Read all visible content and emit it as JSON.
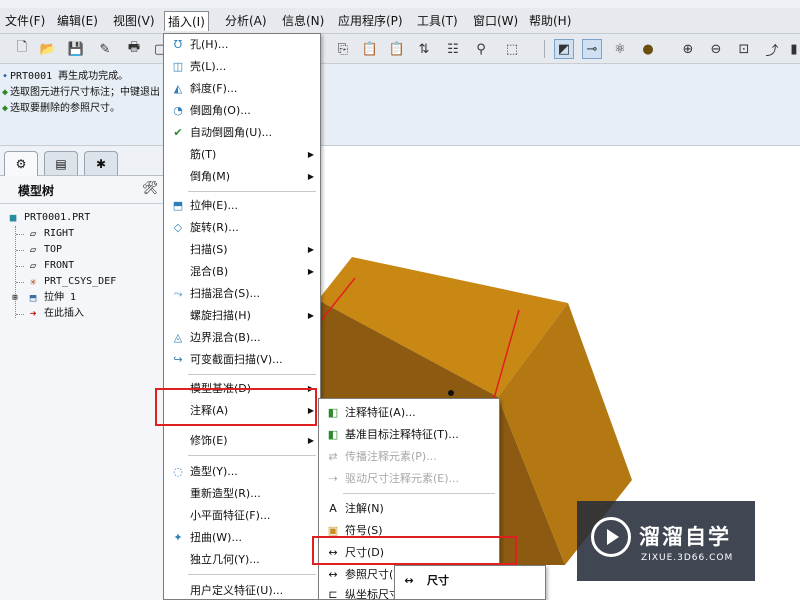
{
  "menubar": {
    "items": [
      "文件(F)",
      "编辑(E)",
      "视图(V)",
      "插入(I)",
      "分析(A)",
      "信息(N)",
      "应用程序(P)",
      "工具(T)",
      "窗口(W)",
      "帮助(H)"
    ],
    "active": "插入(I)"
  },
  "toolbar": {
    "icons": [
      "new-file-icon",
      "open-folder-icon",
      "save-icon",
      "rename-icon",
      "print-icon",
      "window-icon",
      "copy-icon",
      "paste-icon",
      "paste-special-icon",
      "regenerate-icon",
      "model-tree-icon",
      "find-icon",
      "selection-box-icon",
      "datum-plane-display-icon",
      "datum-axis-display-icon",
      "datum-point-display-icon",
      "shading-sphere-icon",
      "zoom-in-icon",
      "zoom-out-icon",
      "refit-icon",
      "orient-icon",
      "view-manager-icon"
    ]
  },
  "messages": [
    {
      "type": "info",
      "text": "PRT0001 再生成功完成。"
    },
    {
      "type": "prompt",
      "text": "选取图元进行尺寸标注；中键退出"
    },
    {
      "type": "prompt",
      "text": "选取要删除的参照尺寸。"
    }
  ],
  "left_panel": {
    "tabs": [
      "model-tree-tab",
      "layers-tab",
      "favorites-tab"
    ],
    "title": "模型树",
    "tree": [
      {
        "label": "PRT0001.PRT",
        "icon": "part-icon"
      },
      {
        "label": "RIGHT",
        "icon": "datum-plane-icon"
      },
      {
        "label": "TOP",
        "icon": "datum-plane-icon"
      },
      {
        "label": "FRONT",
        "icon": "datum-plane-icon"
      },
      {
        "label": "PRT_CSYS_DEF",
        "icon": "csys-icon"
      },
      {
        "label": "拉伸 1",
        "icon": "extrude-icon"
      },
      {
        "label": "在此插入",
        "icon": "insert-here-arrow-icon"
      }
    ]
  },
  "insert_menu": {
    "items": [
      {
        "label": "孔(H)...",
        "icon": "hole-icon"
      },
      {
        "label": "壳(L)...",
        "icon": "shell-icon"
      },
      {
        "label": "斜度(F)...",
        "icon": "draft-icon"
      },
      {
        "label": "倒圆角(O)...",
        "icon": "round-icon"
      },
      {
        "label": "自动倒圆角(U)...",
        "icon": "auto-round-icon"
      },
      {
        "label": "筋(T)",
        "submenu": true
      },
      {
        "label": "倒角(M)",
        "submenu": true
      },
      {
        "label": "拉伸(E)...",
        "icon": "extrude-icon"
      },
      {
        "label": "旋转(R)...",
        "icon": "revolve-icon"
      },
      {
        "label": "扫描(S)",
        "submenu": true
      },
      {
        "label": "混合(B)",
        "submenu": true
      },
      {
        "label": "扫描混合(S)...",
        "icon": "swept-blend-icon"
      },
      {
        "label": "螺旋扫描(H)",
        "submenu": true
      },
      {
        "label": "边界混合(B)...",
        "icon": "boundary-blend-icon"
      },
      {
        "label": "可变截面扫描(V)...",
        "icon": "var-sec-sweep-icon"
      },
      {
        "label": "模型基准(D)",
        "submenu": true
      },
      {
        "label": "注释(A)",
        "submenu": true
      },
      {
        "label": "修饰(E)",
        "submenu": true
      },
      {
        "label": "造型(Y)...",
        "icon": "style-icon"
      },
      {
        "label": "重新造型(R)..."
      },
      {
        "label": "小平面特征(F)..."
      },
      {
        "label": "扭曲(W)...",
        "icon": "warp-icon"
      },
      {
        "label": "独立几何(Y)..."
      },
      {
        "label": "用户定义特征(U)..."
      }
    ]
  },
  "annotation_submenu": {
    "items": [
      {
        "label": "注释特征(A)...",
        "icon": "annotation-feature-icon",
        "enabled": true
      },
      {
        "label": "基准目标注释特征(T)...",
        "icon": "datum-target-icon",
        "enabled": true
      },
      {
        "label": "传播注释元素(P)...",
        "icon": "propagate-icon",
        "enabled": false
      },
      {
        "label": "驱动尺寸注释元素(E)...",
        "icon": "driving-dim-icon",
        "enabled": false
      },
      {
        "label": "注解(N)",
        "icon": "note-icon",
        "enabled": true
      },
      {
        "label": "符号(S)",
        "icon": "symbol-icon",
        "enabled": true
      },
      {
        "label": "尺寸(D)",
        "icon": "dimension-icon",
        "enabled": true
      },
      {
        "label": "参照尺寸(F)",
        "icon": "ref-dimension-icon",
        "enabled": true
      },
      {
        "label": "纵坐标尺寸(O)",
        "icon": "ordinate-dimension-icon",
        "enabled": true
      }
    ]
  },
  "dimension_submenu": {
    "items": [
      {
        "label": "尺寸",
        "icon": "dimension-icon"
      }
    ]
  },
  "watermark": {
    "title": "溜溜自学",
    "url": "ZIXUE.3D66.COM"
  }
}
